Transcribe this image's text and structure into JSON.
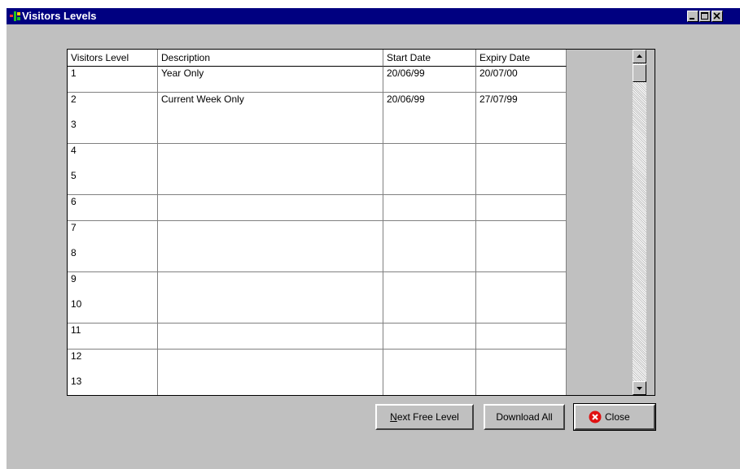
{
  "window": {
    "title": "Visitors Levels",
    "controls": {
      "minimize": "minimize",
      "maximize": "maximize",
      "close": "close"
    }
  },
  "grid": {
    "columns": [
      "Visitors Level",
      "Description",
      "Start Date",
      "Expiry Date"
    ],
    "rows": [
      [
        "1",
        "Year Only",
        "20/06/99",
        "20/07/00"
      ],
      [
        "2",
        "Current Week Only",
        "20/06/99",
        "27/07/99"
      ],
      [
        "3",
        "",
        "",
        ""
      ],
      [
        "4",
        "",
        "",
        ""
      ],
      [
        "5",
        "",
        "",
        ""
      ],
      [
        "6",
        "",
        "",
        ""
      ],
      [
        "7",
        "",
        "",
        ""
      ],
      [
        "8",
        "",
        "",
        ""
      ],
      [
        "9",
        "",
        "",
        ""
      ],
      [
        "10",
        "",
        "",
        ""
      ],
      [
        "11",
        "",
        "",
        ""
      ],
      [
        "12",
        "",
        "",
        ""
      ],
      [
        "13",
        "",
        "",
        ""
      ]
    ]
  },
  "buttons": {
    "next_free_level_first": "N",
    "next_free_level_rest": "ext Free Level",
    "download_all": "Download All",
    "close": "Close"
  },
  "colors": {
    "titlebar": "#000080",
    "face": "#c0c0c0",
    "close_icon": "#e01010"
  },
  "icons": {
    "app": "app-logo-icon",
    "close_button": "close-circle-x-icon",
    "scroll_up": "arrow-up-icon",
    "scroll_down": "arrow-down-icon"
  }
}
